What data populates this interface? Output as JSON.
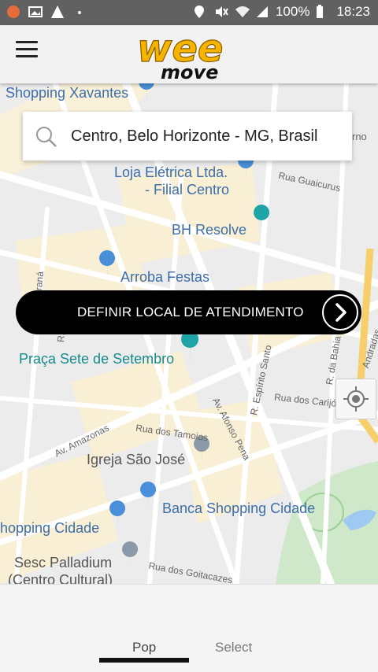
{
  "status_bar": {
    "battery": "100%",
    "time": "18:23"
  },
  "app": {
    "logo_top": "wee",
    "logo_bottom": "move"
  },
  "search": {
    "value": "Centro, Belo Horizonte - MG, Brasil",
    "right_clip": "rno"
  },
  "map": {
    "pois": [
      "Shopping Xavantes",
      "Loja Elétrica Ltda.",
      "- Filial Centro",
      "BH Resolve",
      "Arroba Festas",
      "Praça Sete de Setembro",
      "Igreja São José",
      "Banca Shopping Cidade",
      "hopping Cidade",
      "Sesc Palladium",
      "(Centro Cultural)"
    ],
    "streets": [
      "Rua Guaicurus",
      "Av. Afonso Pena",
      "R. Espírito Santo",
      "R. da Bahia",
      "Rua dos Carijós",
      "Av. Amazonas",
      "Rua dos Tamoios",
      "Rua dos Goitacazes",
      "Andradas",
      "raná",
      "R. C"
    ]
  },
  "action": {
    "label": "DEFINIR LOCAL DE ATENDIMENTO"
  },
  "tabs": [
    {
      "label": "Pop"
    },
    {
      "label": "Select"
    }
  ],
  "colors": {
    "accent": "#f5b400",
    "pill": "#000000",
    "poi_blue": "#4a8fd9",
    "poi_teal": "#1fa5a8"
  },
  "icons": {
    "menu": "hamburger-icon",
    "search": "search-icon",
    "next": "chevron-right-icon",
    "locate": "my-location-icon"
  }
}
